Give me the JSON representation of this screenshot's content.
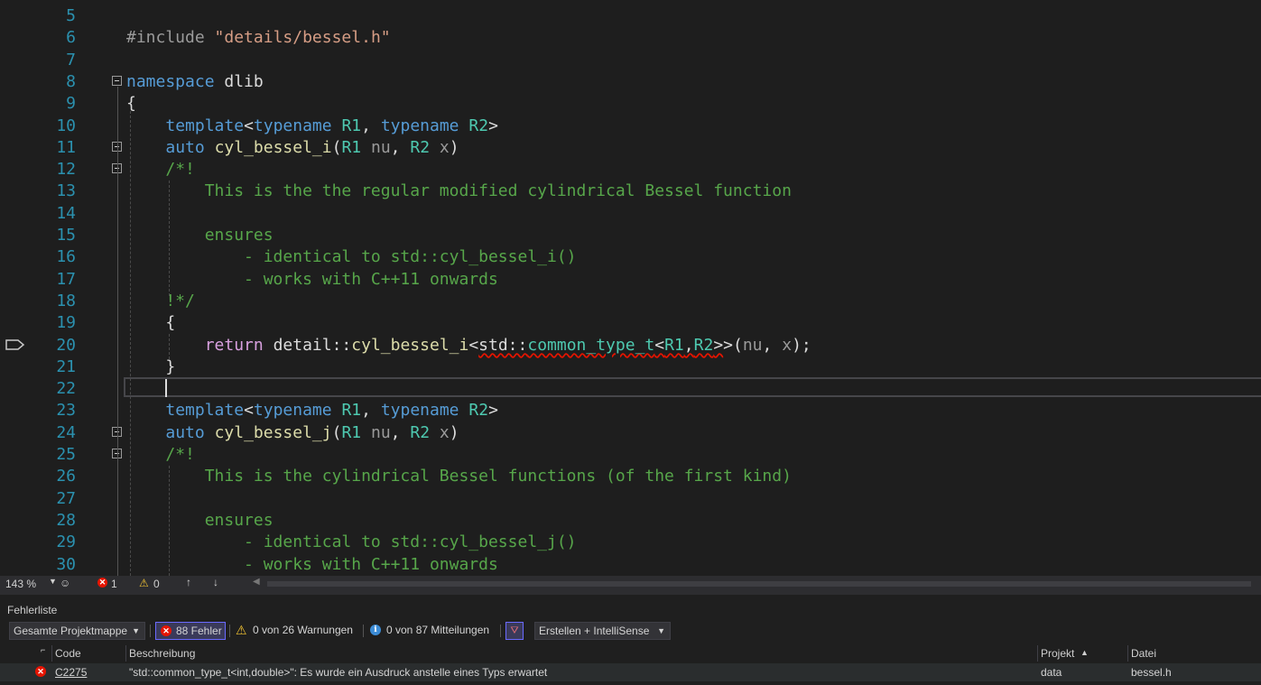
{
  "editor": {
    "lines": [
      {
        "n": "5",
        "html": ""
      },
      {
        "n": "6",
        "html": "<span class=\"pp\">#include</span> <span class=\"str\">\"details/bessel.h\"</span>"
      },
      {
        "n": "7",
        "html": ""
      },
      {
        "n": "8",
        "html": "<span class=\"kw\">namespace</span> dlib"
      },
      {
        "n": "9",
        "html": "{"
      },
      {
        "n": "10",
        "html": "    <span class=\"kw\">template</span>&lt;<span class=\"kw\">typename</span> <span class=\"ty\">R1</span>, <span class=\"kw\">typename</span> <span class=\"ty\">R2</span>&gt;"
      },
      {
        "n": "11",
        "html": "    <span class=\"kw\">auto</span> <span class=\"fn\">cyl_bessel_i</span>(<span class=\"ty\">R1</span> <span class=\"par\">nu</span>, <span class=\"ty\">R2</span> <span class=\"par\">x</span>)"
      },
      {
        "n": "12",
        "html": "    <span class=\"cm\">/*!</span>"
      },
      {
        "n": "13",
        "html": "<span class=\"cm\">        This is the the regular modified cylindrical Bessel function</span>"
      },
      {
        "n": "14",
        "html": ""
      },
      {
        "n": "15",
        "html": "<span class=\"cm\">        ensures</span>"
      },
      {
        "n": "16",
        "html": "<span class=\"cm\">            - identical to std::cyl_bessel_i()</span>"
      },
      {
        "n": "17",
        "html": "<span class=\"cm\">            - works with C++11 onwards</span>"
      },
      {
        "n": "18",
        "html": "<span class=\"cm\">    !*/</span>"
      },
      {
        "n": "19",
        "html": "    {"
      },
      {
        "n": "20",
        "html": "        <span class=\"ctl\">return</span> detail::<span class=\"fn\">cyl_bessel_i</span>&lt;<span class=\"squig\">std::<span class=\"ty\">common_type_t</span>&lt;<span class=\"ty\">R1</span>,<span class=\"ty\">R2</span>&gt;</span>&gt;(<span class=\"par\">nu</span>, <span class=\"par\">x</span>);"
      },
      {
        "n": "21",
        "html": "    }"
      },
      {
        "n": "22",
        "html": ""
      },
      {
        "n": "23",
        "html": "    <span class=\"kw\">template</span>&lt;<span class=\"kw\">typename</span> <span class=\"ty\">R1</span>, <span class=\"kw\">typename</span> <span class=\"ty\">R2</span>&gt;"
      },
      {
        "n": "24",
        "html": "    <span class=\"kw\">auto</span> <span class=\"fn\">cyl_bessel_j</span>(<span class=\"ty\">R1</span> <span class=\"par\">nu</span>, <span class=\"ty\">R2</span> <span class=\"par\">x</span>)"
      },
      {
        "n": "25",
        "html": "    <span class=\"cm\">/*!</span>"
      },
      {
        "n": "26",
        "html": "<span class=\"cm\">        This is the cylindrical Bessel functions (of the first kind)</span>"
      },
      {
        "n": "27",
        "html": ""
      },
      {
        "n": "28",
        "html": "<span class=\"cm\">        ensures</span>"
      },
      {
        "n": "29",
        "html": "<span class=\"cm\">            - identical to std::cyl_bessel_j()</span>"
      },
      {
        "n": "30",
        "html": "<span class=\"cm\">            - works with C++11 onwards</span>"
      }
    ]
  },
  "status": {
    "zoom": "143 %",
    "errors": "1",
    "warnings": "0"
  },
  "error_list": {
    "title": "Fehlerliste",
    "scope": "Gesamte Projektmappe",
    "errors_btn": "88 Fehler",
    "warnings_btn": "0 von 26 Warnungen",
    "messages_btn": "0 von 87 Mitteilungen",
    "source": "Erstellen + IntelliSense",
    "columns": {
      "code": "Code",
      "description": "Beschreibung",
      "project": "Projekt",
      "file": "Datei"
    },
    "rows": [
      {
        "code": "C2275",
        "description": "\"std::common_type_t<int,double>\": Es wurde ein Ausdruck anstelle eines Typs erwartet",
        "project": "data",
        "file": "bessel.h"
      }
    ]
  },
  "colors": {
    "error": "#e51400",
    "warning": "#f1c232",
    "keyword": "#569cd6",
    "type": "#4ec9b0",
    "comment": "#57a64a"
  }
}
